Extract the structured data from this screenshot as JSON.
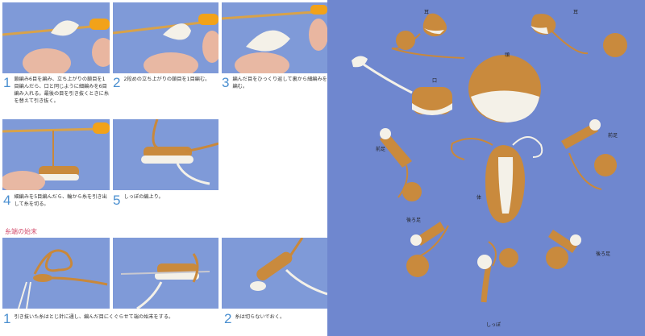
{
  "left_page": {
    "steps_top": [
      {
        "num": "1",
        "text": "鎖編み6目を編み、立ち上がりの鎖目を1目編んだら、口と同じように細編みを6目編み入れる。最後の目を引き抜くときに糸を替えて引き抜く。"
      },
      {
        "num": "2",
        "text": "2段めの立ち上がりの鎖目を1目編む。"
      },
      {
        "num": "3",
        "text": "編んだ目をひっくり返して裏から細編みを編む。"
      },
      {
        "num": "4",
        "text": "細編みを5目編んだら、輪から糸を引き出して糸を切る。"
      },
      {
        "num": "5",
        "text": "しっぽの編上り。"
      }
    ],
    "section_title": "糸端の始末",
    "steps_bottom": [
      {
        "num": "1",
        "text": "引き抜いた糸はとじ針に通し、編んだ目にくぐらせて端の始末をする。"
      },
      {
        "num": "2",
        "text": "糸は切らないでおく。"
      }
    ]
  },
  "right_page": {
    "labels": [
      {
        "name": "ear-left",
        "text": "耳"
      },
      {
        "name": "ear-right",
        "text": "耳"
      },
      {
        "name": "head",
        "text": "頭"
      },
      {
        "name": "mouth",
        "text": "口"
      },
      {
        "name": "front-leg-left",
        "text": "前足"
      },
      {
        "name": "front-leg-right",
        "text": "前足"
      },
      {
        "name": "body",
        "text": "体"
      },
      {
        "name": "hind-leg-left",
        "text": "後ろ足"
      },
      {
        "name": "hind-leg-right",
        "text": "後ろ足"
      },
      {
        "name": "tail",
        "text": "しっぽ"
      }
    ]
  }
}
